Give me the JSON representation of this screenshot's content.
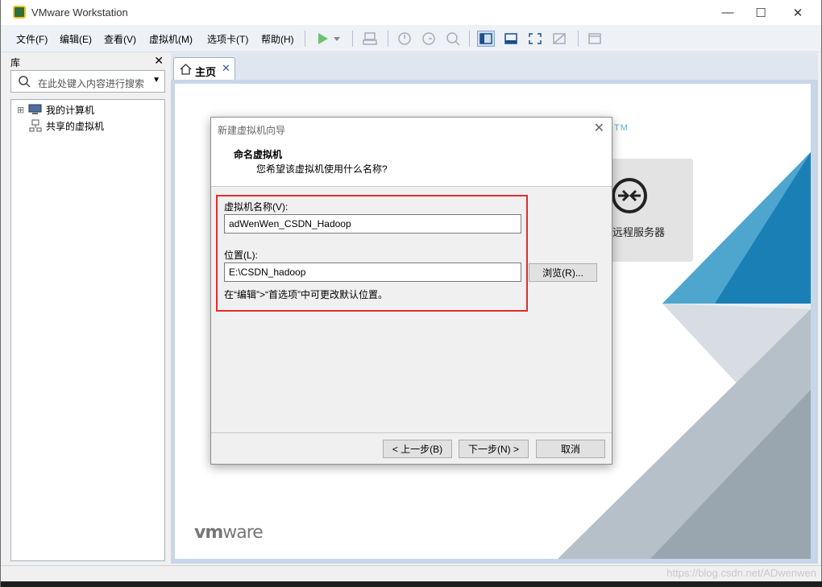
{
  "window": {
    "title": "VMware Workstation",
    "controls": {
      "minimize": "—",
      "maximize": "☐",
      "close": "✕"
    }
  },
  "menu": [
    "文件(F)",
    "编辑(E)",
    "查看(V)",
    "虚拟机(M)",
    "选项卡(T)",
    "帮助(H)"
  ],
  "toolbar": {
    "icons": [
      "play-icon",
      "dropdown-arrow-icon",
      "send-keys-icon",
      "snapshot-icon",
      "revert-snapshot-icon",
      "snapshot-manager-icon",
      "library-view-icon",
      "thumbnail-bar-icon",
      "fullscreen-icon",
      "unity-icon",
      "console-view-icon"
    ]
  },
  "library": {
    "title": "库",
    "close": "✕",
    "search_placeholder": "在此处键入内容进行搜索",
    "items": [
      {
        "label": "我的计算机",
        "expander": "⊞"
      },
      {
        "label": "共享的虚拟机"
      }
    ]
  },
  "tabs": [
    {
      "label": "主页",
      "close": "✕"
    }
  ],
  "home": {
    "tm_fragment": "TM",
    "remote_server_label": "远程服务器",
    "logo_vm": "vm",
    "logo_ware": "ware"
  },
  "dialog": {
    "title": "新建虚拟机向导",
    "close": "✕",
    "heading": "命名虚拟机",
    "subheading": "您希望该虚拟机使用什么名称?",
    "vm_name_label": "虚拟机名称(V):",
    "vm_name_value": "adWenWen_CSDN_Hadoop",
    "location_label": "位置(L):",
    "location_value": "E:\\CSDN_hadoop",
    "browse_button": "浏览(R)...",
    "hint": "在“编辑”>“首选项”中可更改默认位置。",
    "back_button": "< 上一步(B)",
    "next_button": "下一步(N) >",
    "cancel_button": "取消"
  },
  "watermark": "https://blog.csdn.net/ADwenwen",
  "colors": {
    "accent_blue": "#1a7fb5",
    "highlight_red": "#e12d2d",
    "play_green": "#3caa3c"
  }
}
